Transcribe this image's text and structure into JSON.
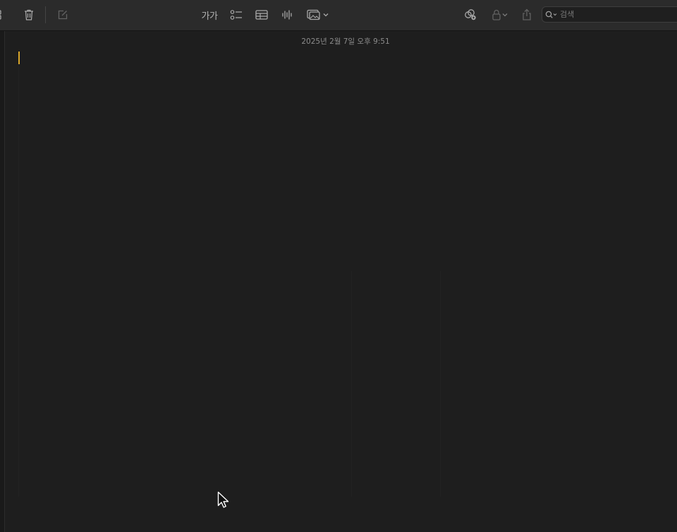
{
  "toolbar": {
    "format_label": "가가",
    "search_placeholder": "검색"
  },
  "icons": {
    "gallery": "gallery-view-icon",
    "delete": "trash-icon",
    "compose": "compose-icon",
    "format": "text-format-icon",
    "checklist": "checklist-icon",
    "table": "table-icon",
    "audio": "waveform-icon",
    "media": "photo-icon",
    "collaborate": "collaborate-icon",
    "lock": "lock-icon",
    "share": "share-icon",
    "search": "search-icon"
  },
  "note": {
    "date": "2025년 2월 7일 오후 9:51",
    "body": ""
  },
  "colors": {
    "background": "#1e1e1e",
    "toolbar": "#2b2b2b",
    "caret": "#d9a62a"
  }
}
